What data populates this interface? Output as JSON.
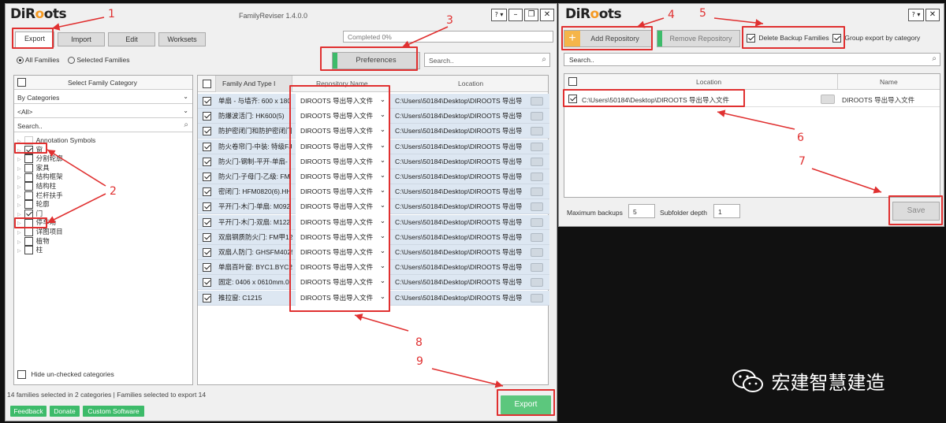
{
  "left_window": {
    "logo": "DiRoots",
    "title": "FamilyReviser 1.4.0.0",
    "help_btn": "? ▾",
    "tabs": [
      "Export",
      "Import",
      "Edit",
      "Worksets"
    ],
    "progress": {
      "label": "Completed 0%",
      "fraction": 0.0
    },
    "radio_all": "All Families",
    "radio_selected": "Selected Families",
    "preferences_label": "Preferences",
    "search_placeholder": "Search..",
    "category_header": "Select Family Category",
    "by_categories": "By Categories",
    "all_option": "<All>",
    "cat_search_placeholder": "Search..",
    "tree": [
      {
        "label": "Annotation Symbols",
        "checked": false,
        "partial": true
      },
      {
        "label": "窗",
        "checked": true
      },
      {
        "label": "分割轮廓",
        "checked": false
      },
      {
        "label": "家具",
        "checked": false
      },
      {
        "label": "结构框架",
        "checked": false
      },
      {
        "label": "结构柱",
        "checked": false
      },
      {
        "label": "栏杆扶手",
        "checked": false
      },
      {
        "label": "轮廓",
        "checked": false
      },
      {
        "label": "门",
        "checked": true
      },
      {
        "label": "停车场",
        "checked": false
      },
      {
        "label": "详图项目",
        "checked": false
      },
      {
        "label": "植物",
        "checked": false
      },
      {
        "label": "柱",
        "checked": false
      }
    ],
    "hide_unchecked": "Hide un-checked categories",
    "table_headers": {
      "family": "Family And Type I",
      "repo": "Repository Name",
      "location": "Location"
    },
    "rows": [
      {
        "family": "单扇 - 与墙齐: 600 x 180",
        "repo": "DIROOTS 导出导入文件",
        "location": "C:\\Users\\50184\\Desktop\\DIROOTS 导出导"
      },
      {
        "family": "防爆波活门: HK600(5)",
        "repo": "DIROOTS 导出导入文件",
        "location": "C:\\Users\\50184\\Desktop\\DIROOTS 导出导"
      },
      {
        "family": "防护密闭门和防护密闭门",
        "repo": "DIROOTS 导出导入文件",
        "location": "C:\\Users\\50184\\Desktop\\DIROOTS 导出导"
      },
      {
        "family": "防火卷帘门-中装: 特级FJ",
        "repo": "DIROOTS 导出导入文件",
        "location": "C:\\Users\\50184\\Desktop\\DIROOTS 导出导"
      },
      {
        "family": "防火门-钢制-平开-单扇-",
        "repo": "DIROOTS 导出导入文件",
        "location": "C:\\Users\\50184\\Desktop\\DIROOTS 导出导"
      },
      {
        "family": "防火门-子母门-乙级: FM",
        "repo": "DIROOTS 导出导入文件",
        "location": "C:\\Users\\50184\\Desktop\\DIROOTS 导出导"
      },
      {
        "family": "密闭门: HFM0820(6).HH",
        "repo": "DIROOTS 导出导入文件",
        "location": "C:\\Users\\50184\\Desktop\\DIROOTS 导出导"
      },
      {
        "family": "平开门-木门-单扇: M092",
        "repo": "DIROOTS 导出导入文件",
        "location": "C:\\Users\\50184\\Desktop\\DIROOTS 导出导"
      },
      {
        "family": "平开门-木门-双扇: M122",
        "repo": "DIROOTS 导出导入文件",
        "location": "C:\\Users\\50184\\Desktop\\DIROOTS 导出导"
      },
      {
        "family": "双扇钢质防火门: FM甲12",
        "repo": "DIROOTS 导出导入文件",
        "location": "C:\\Users\\50184\\Desktop\\DIROOTS 导出导"
      },
      {
        "family": "双扇人防门: GHSFM4025",
        "repo": "DIROOTS 导出导入文件",
        "location": "C:\\Users\\50184\\Desktop\\DIROOTS 导出导"
      },
      {
        "family": "单扇百叶窗: BYC1.BYC2",
        "repo": "DIROOTS 导出导入文件",
        "location": "C:\\Users\\50184\\Desktop\\DIROOTS 导出导"
      },
      {
        "family": "固定: 0406 x 0610mm.0",
        "repo": "DIROOTS 导出导入文件",
        "location": "C:\\Users\\50184\\Desktop\\DIROOTS 导出导"
      },
      {
        "family": "推拉窗: C1215",
        "repo": "DIROOTS 导出导入文件",
        "location": "C:\\Users\\50184\\Desktop\\DIROOTS 导出导"
      }
    ],
    "status": "14 families selected in 2 categories | Families selected to export 14",
    "export_label": "Export",
    "links": [
      "Feedback",
      "Donate",
      "Custom Software"
    ]
  },
  "right_window": {
    "logo": "DiRoots",
    "help_btn": "? ▾",
    "add_repo": "Add Repository",
    "remove_repo": "Remove Repository",
    "delete_backup": "Delete Backup Families",
    "group_export": "Group export by category",
    "search_placeholder": "Search..",
    "headers": {
      "location": "Location",
      "name": "Name"
    },
    "repo_row": {
      "location": "C:\\Users\\50184\\Desktop\\DIROOTS 导出导入文件",
      "name": "DIROOTS 导出导入文件"
    },
    "max_backups_label": "Maximum backups",
    "max_backups_value": "5",
    "subfolder_label": "Subfolder depth",
    "subfolder_value": "1",
    "save_label": "Save"
  },
  "annotations": [
    "1",
    "2",
    "3",
    "4",
    "5",
    "6",
    "7",
    "8",
    "9"
  ],
  "watermark": "宏建智慧建造",
  "colors": {
    "accent_green": "#3dbb6a",
    "annotation_red": "#e03030",
    "row_blue": "#dde7f2",
    "plus_orange": "#f59a23"
  }
}
